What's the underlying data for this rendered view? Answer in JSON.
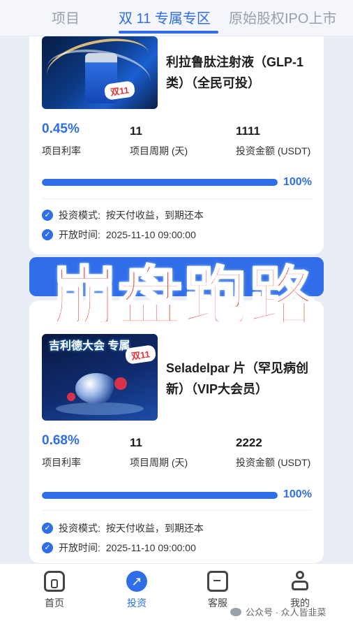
{
  "tabs": [
    "项目",
    "双 11 专属专区",
    "原始股权IPO上市"
  ],
  "active_tab_index": 1,
  "accent_color": "#2f6ee8",
  "products": [
    {
      "name": "利拉鲁肽注射液（GLP-1 类）（全民可投）",
      "thumb_badge": "双11",
      "rate": "0.45%",
      "rate_label": "项目利率",
      "period": "11",
      "period_label": "项目周期 (天)",
      "amount": "1111",
      "amount_label": "投资金额 (USDT)",
      "progress_percent": 100,
      "progress_text": "100%",
      "mode_label": "投资模式:",
      "mode_value": "按天付收益，到期还本",
      "open_label": "开放时间:",
      "open_value": "2025-11-10 09:00:00"
    },
    {
      "name": "Seladelpar 片（罕见病创新）（VIP大会员）",
      "thumb_title": "吉利德大会 专属",
      "thumb_badge": "双11",
      "rate": "0.68%",
      "rate_label": "项目利率",
      "period": "11",
      "period_label": "项目周期 (天)",
      "amount": "2222",
      "amount_label": "投资金额 (USDT)",
      "progress_percent": 100,
      "progress_text": "100%",
      "mode_label": "投资模式:",
      "mode_value": "按天付收益，到期还本",
      "open_label": "开放时间:",
      "open_value": "2025-11-10 09:00:00"
    }
  ],
  "overlay_text": "崩盘跑路",
  "overlay_color": "#e8332c",
  "nav": [
    {
      "label": "首页",
      "icon": "home-icon"
    },
    {
      "label": "投资",
      "icon": "invest-icon"
    },
    {
      "label": "客服",
      "icon": "chat-icon"
    },
    {
      "label": "我的",
      "icon": "profile-icon"
    }
  ],
  "active_nav_index": 1,
  "watermark": "公众号 · 众人皆韭菜"
}
